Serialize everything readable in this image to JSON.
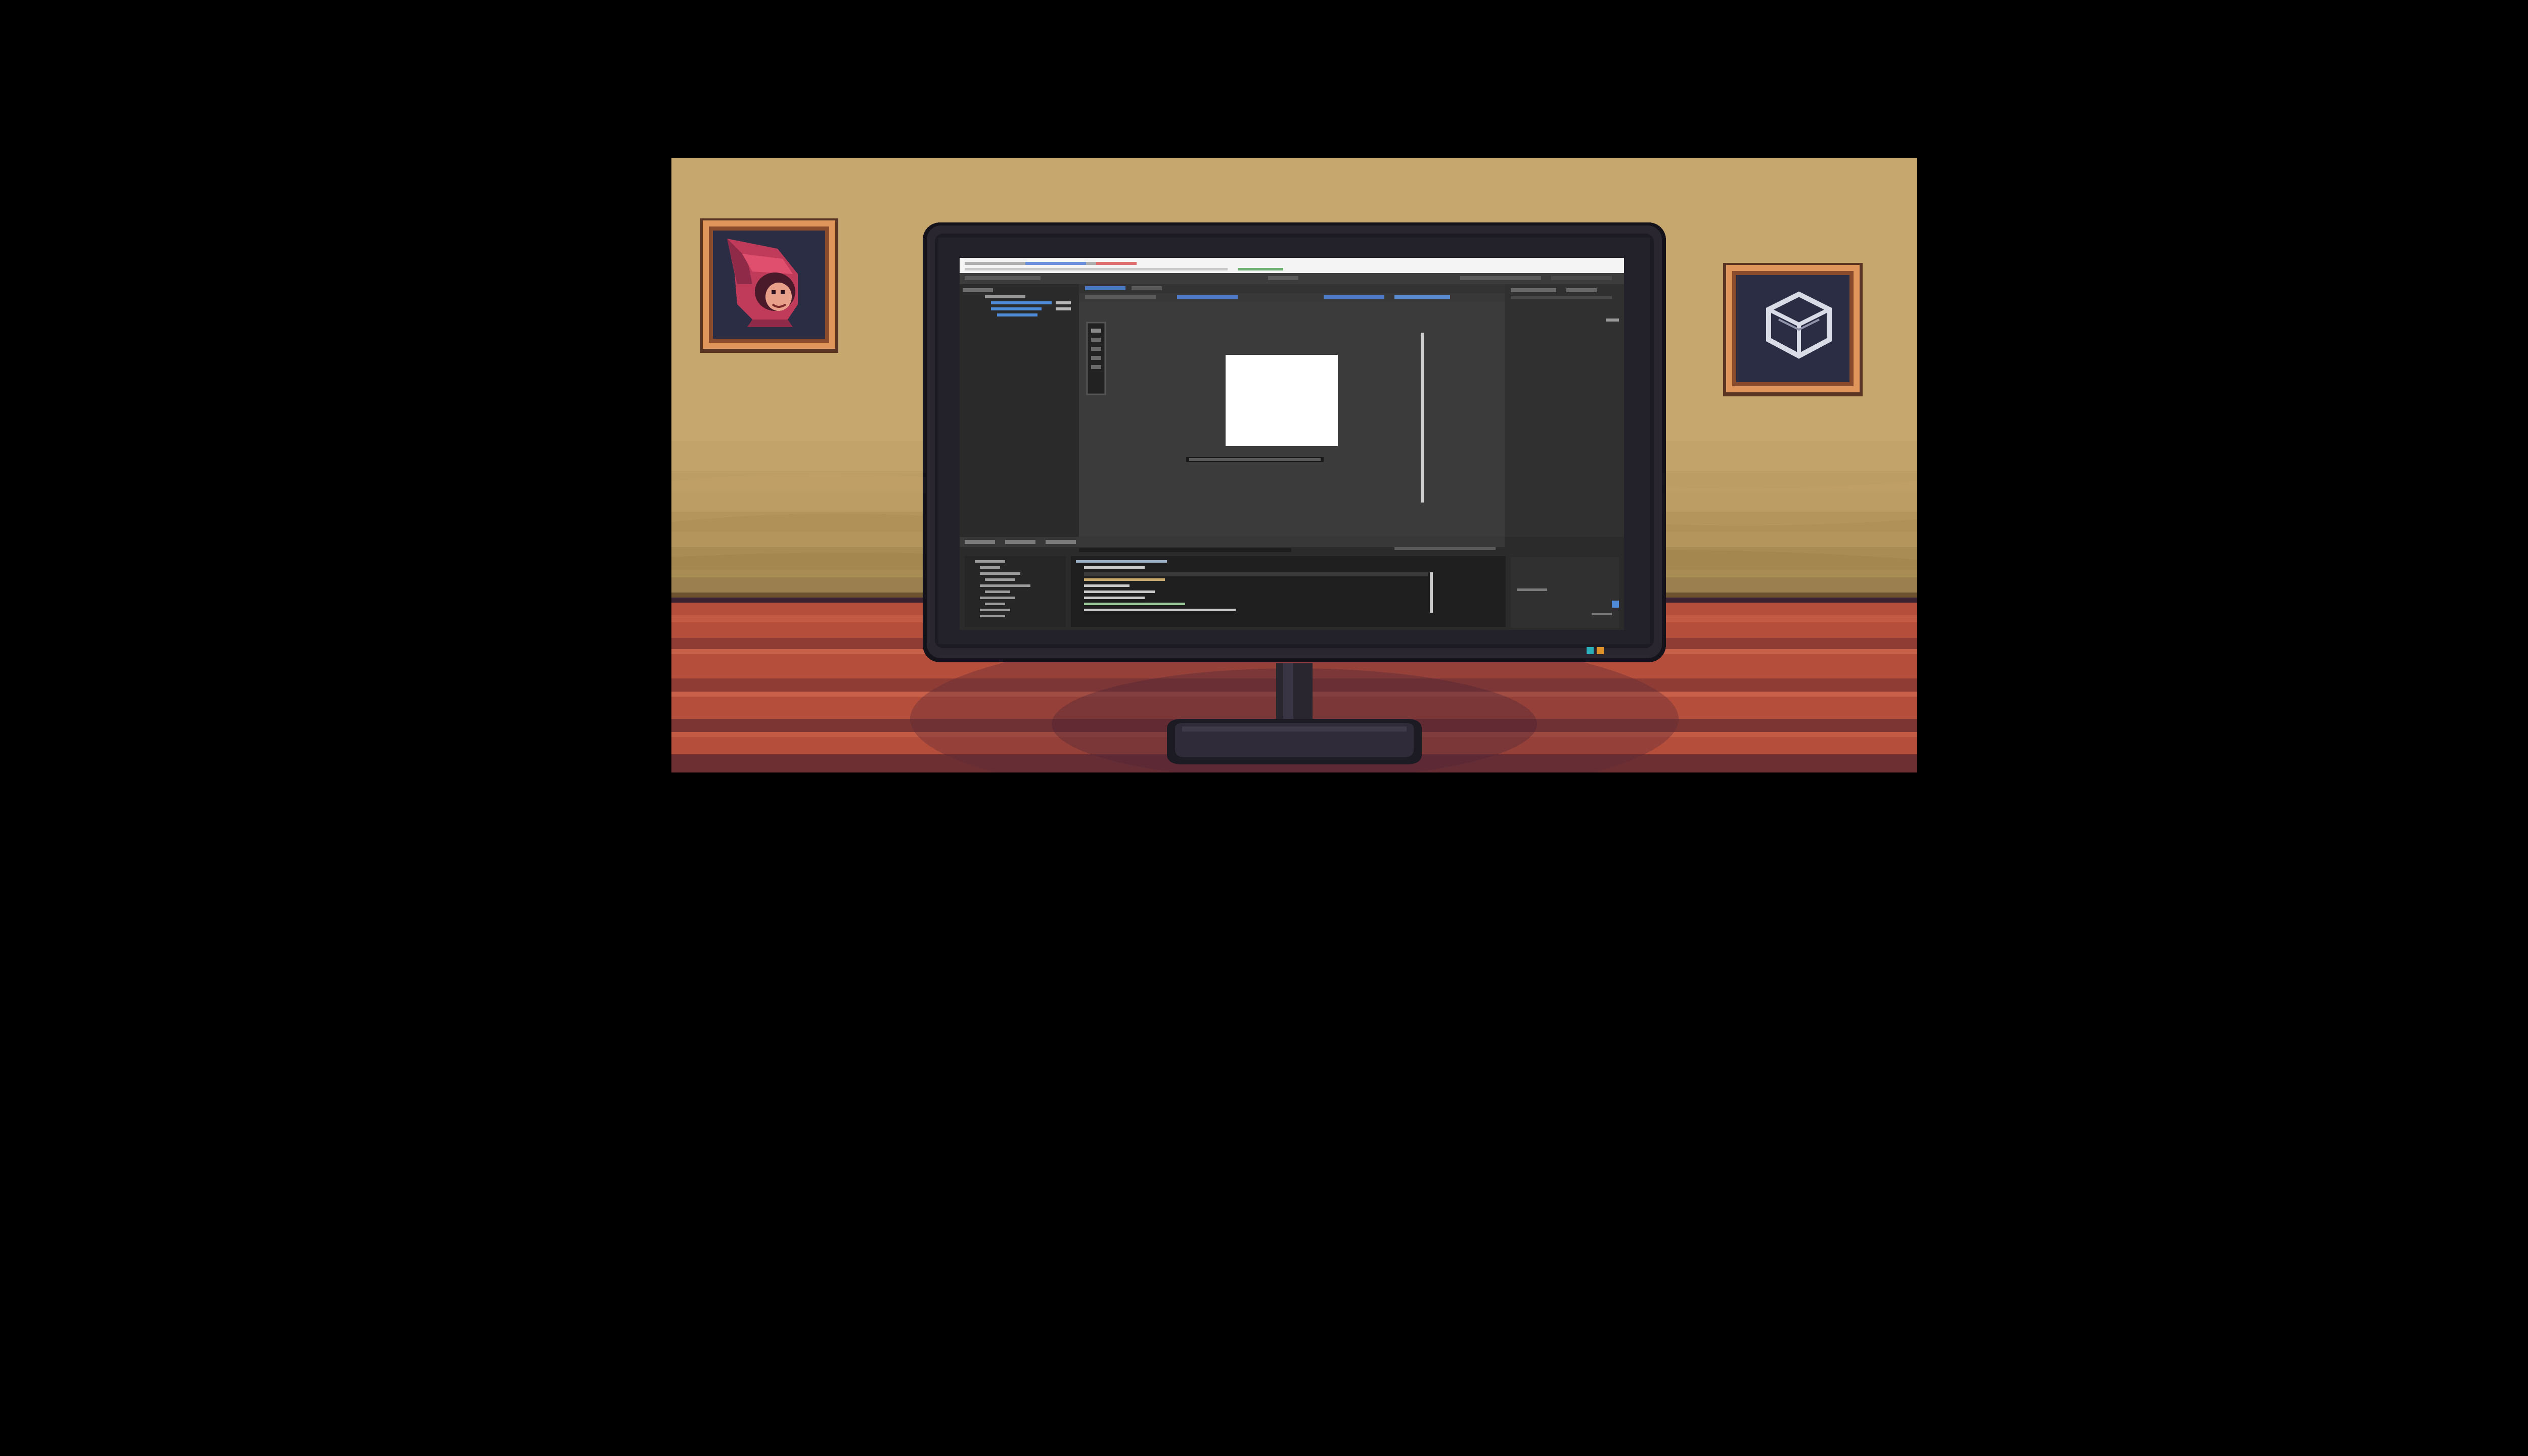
{
  "scene": {
    "description_colors": {
      "wall_top": "#c6a86f",
      "wall_mid": "#bfa066",
      "wall_bottom": "#9c7f4e",
      "desk": "#b54e3b",
      "desk_dark": "#7c3532",
      "monitor_frame": "#2a2630",
      "monitor_bezel": "#1c1a22",
      "picture_frame": "#e0955a",
      "picture_bg": "#2b2d45"
    },
    "left_picture": {
      "icon": "hooded-figure-icon"
    },
    "right_picture": {
      "icon": "cube-icon"
    },
    "monitor": {
      "leds": [
        "#2ab0b8",
        "#e0922a"
      ],
      "screen": {
        "app": "game-engine-editor",
        "theme": "dark"
      }
    }
  }
}
